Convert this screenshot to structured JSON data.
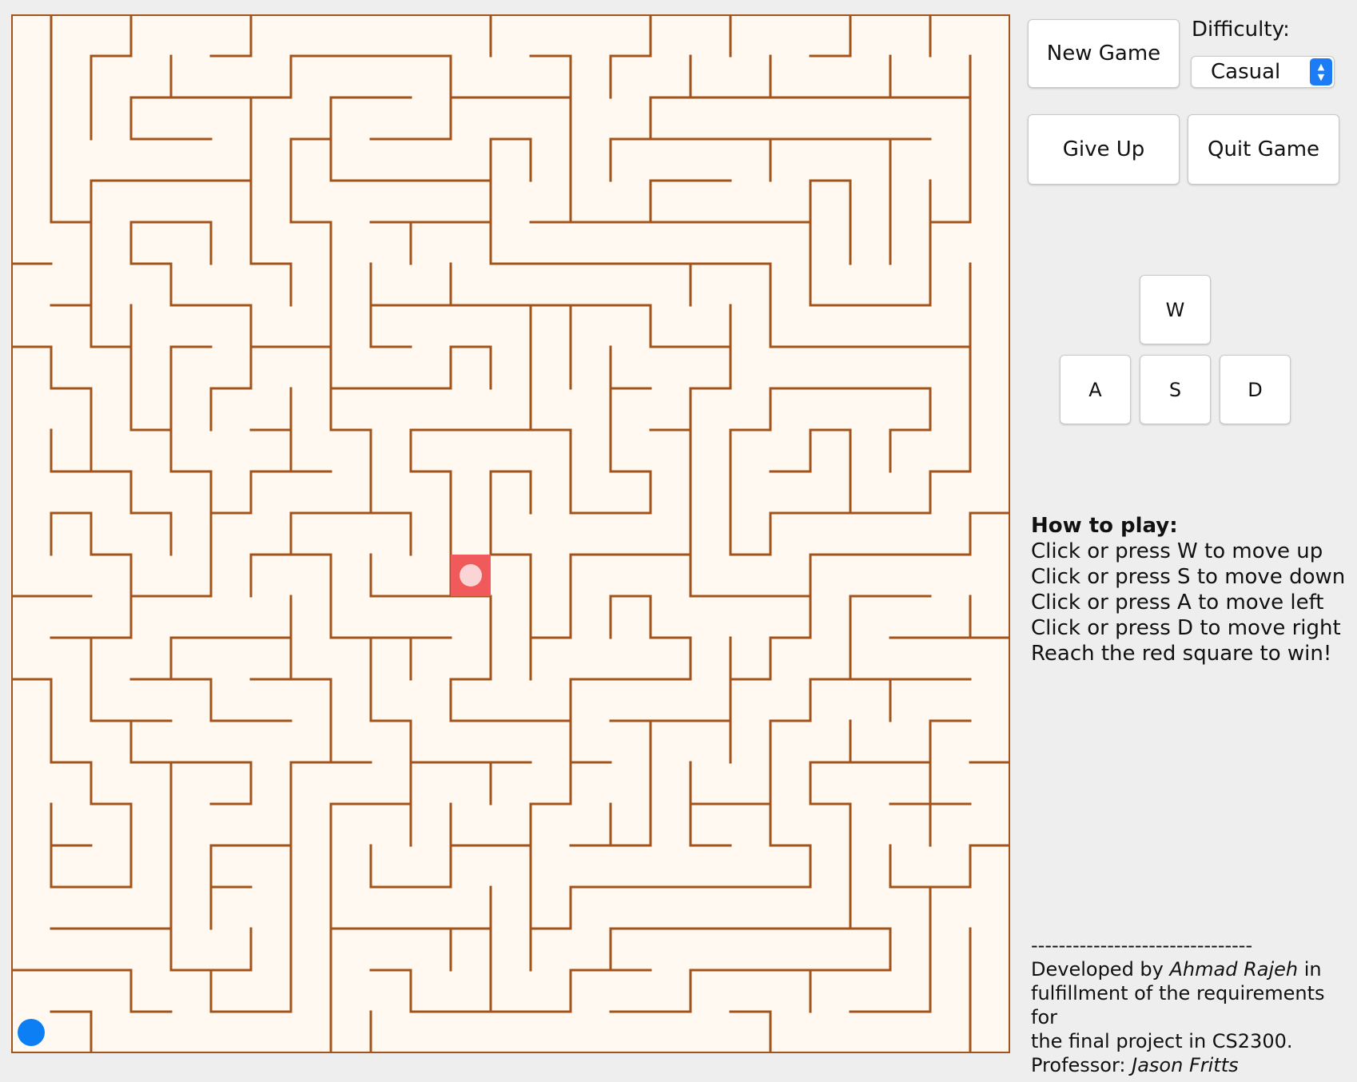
{
  "controls": {
    "new_game_label": "New Game",
    "give_up_label": "Give Up",
    "quit_game_label": "Quit Game",
    "difficulty_label": "Difficulty:",
    "difficulty_value": "Casual"
  },
  "keys": {
    "up": "W",
    "left": "A",
    "down": "S",
    "right": "D"
  },
  "instructions": {
    "title": "How to play:",
    "lines": [
      "Click or press W to move up",
      "Click or press S to move down",
      "Click or press A to move left",
      "Click or press D to move right",
      "Reach the red square to win!"
    ]
  },
  "credits": {
    "divider": "--------------------------------",
    "developed_by_prefix": "Developed by ",
    "developer_name": "Ahmad Rajeh",
    "developed_by_suffix": " in",
    "line2": "fulfillment of the requirements for",
    "line3": "the final project in CS2300.",
    "professor_prefix": "Professor: ",
    "professor_name": "Jason Fritts"
  },
  "colors": {
    "maze_background": "#fff9f1",
    "maze_wall": "#a3541a",
    "goal_square": "#f05a5a",
    "goal_dot": "#fbd5d5",
    "player": "#0d7ff5",
    "select_accent": "#1b7cf5"
  },
  "maze": {
    "rows": 25,
    "cols": 25,
    "player_cell": {
      "row": 24,
      "col": 0
    },
    "goal_cell": {
      "row": 13,
      "col": 11
    }
  }
}
